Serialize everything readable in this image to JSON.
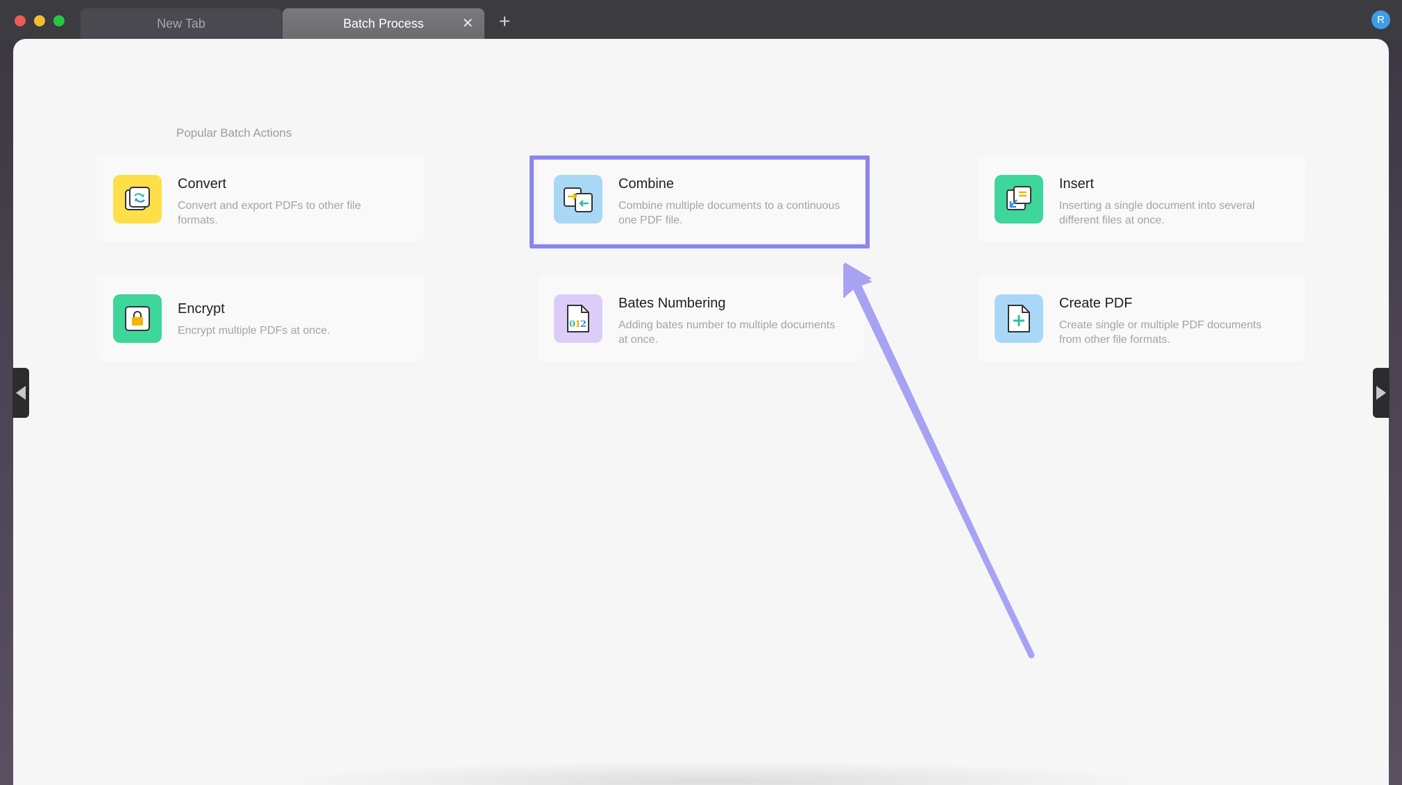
{
  "tabs": [
    {
      "label": "New Tab",
      "active": false
    },
    {
      "label": "Batch Process",
      "active": true
    }
  ],
  "tab_close_glyph": "✕",
  "new_tab_glyph": "+",
  "avatar_initial": "R",
  "section_title": "Popular Batch Actions",
  "actions": [
    {
      "title": "Convert",
      "description": "Convert and export PDFs to other file formats.",
      "icon": "convert-icon",
      "icon_bg": "#fddf4a"
    },
    {
      "title": "Combine",
      "description": "Combine multiple documents to a continuous one PDF file.",
      "icon": "combine-icon",
      "icon_bg": "#a9d8f6"
    },
    {
      "title": "Insert",
      "description": "Inserting a single document into several different files at once.",
      "icon": "insert-icon",
      "icon_bg": "#3ed69b"
    },
    {
      "title": "Encrypt",
      "description": "Encrypt multiple PDFs at once.",
      "icon": "lock-icon",
      "icon_bg": "#3ed69b"
    },
    {
      "title": "Bates Numbering",
      "description": "Adding bates number to multiple documents at once.",
      "icon": "bates-number-icon",
      "icon_bg": "#dccdf8",
      "icon_text": "012"
    },
    {
      "title": "Create PDF",
      "description": "Create single or multiple PDF documents from other file formats.",
      "icon": "create-pdf-icon",
      "icon_bg": "#a9d8f6"
    }
  ],
  "highlighted_action": "Combine",
  "annotation_color": "#8c85ee"
}
